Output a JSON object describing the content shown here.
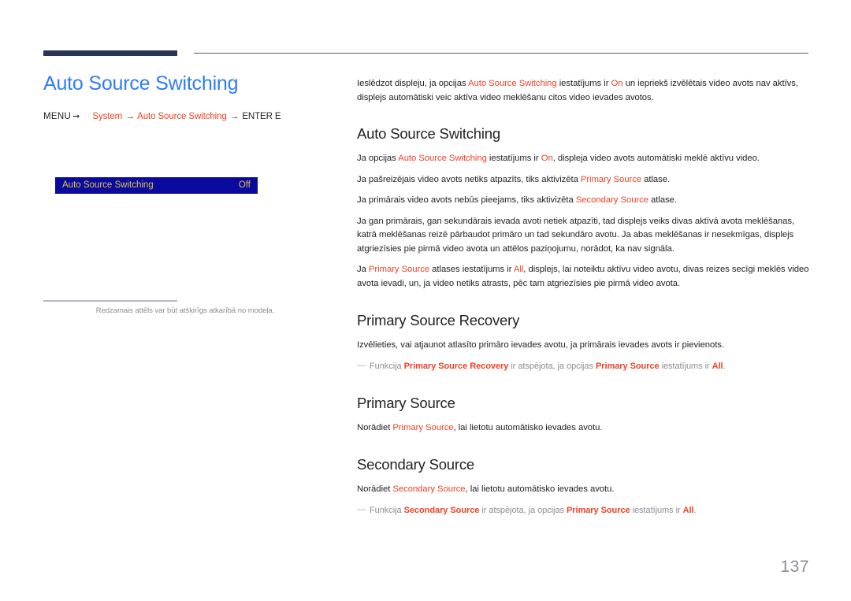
{
  "header": {
    "accent_color": "#2b3356",
    "rule_color": "#5c5a72"
  },
  "left": {
    "title": "Auto Source Switching",
    "title_color": "#2f7cf6",
    "menu": {
      "menu_word": "MENU",
      "return_icon": "return-arrow-icon",
      "step1": "System",
      "arrow1": "→",
      "step2": "Auto Source Switching",
      "arrow2": "→",
      "step3": "ENTER E"
    },
    "osd": {
      "label": "Auto Source Switching",
      "value": "Off",
      "bg_color": "#0a0a9e",
      "text_color": "#e3c14a"
    },
    "caption": "Redzamais attēls var būt atšķirīgs atkarībā no modeļa."
  },
  "right": {
    "intro": {
      "t1": "Ieslēdzot displeju, ja opcijas ",
      "h1": "Auto Source Switching",
      "t2": " iestatījums ir ",
      "h2": "On",
      "t3": " un iepriekš izvēlētais video avots nav aktīvs, displejs automātiski veic aktīva video meklēšanu citos video ievades avotos."
    },
    "sections": [
      {
        "heading": "Auto Source Switching",
        "paragraphs": [
          {
            "t1": "Ja opcijas ",
            "h1": "Auto Source Switching",
            "t2": " iestatījums ir ",
            "h2": "On",
            "t3": ", displeja video avots automātiski meklē aktīvu video."
          },
          {
            "t1": "Ja pašreizējais video avots netiks atpazīts, tiks aktivizēta ",
            "h1": "Primary Source",
            "t2": " atlase."
          },
          {
            "t1": "Ja primārais video avots nebūs pieejams, tiks aktivizēta ",
            "h1": "Secondary Source",
            "t2": " atlase."
          },
          {
            "t1": "Ja gan primārais, gan sekundārais ievada avoti netiek atpazīti, tad displejs veiks divas aktīvā avota meklēšanas, katrā meklēšanas reizē pārbaudot primāro un tad sekundāro avotu. Ja abas meklēšanas ir nesekmīgas, displejs atgriezīsies pie pirmā video avota un attēlos paziņojumu, norādot, ka nav signāla."
          },
          {
            "t1": "Ja ",
            "h1": "Primary Source",
            "t2": " atlases iestatījums ir ",
            "h2": "All",
            "t3": ", displejs, lai noteiktu aktīvu video avotu, divas reizes secīgi meklēs video avota ievadi, un, ja video netiks atrasts, pēc tam atgriezīsies pie pirmā video avota."
          }
        ],
        "notes": []
      },
      {
        "heading": "Primary Source Recovery",
        "paragraphs": [
          {
            "t1": "Izvēlieties, vai atjaunot atlasīto primāro ievades avotu, ja primārais ievades avots ir pievienots."
          }
        ],
        "notes": [
          {
            "dash": "―",
            "t1": "Funkcija ",
            "h1": "Primary Source Recovery",
            "t2": " ir atspējota, ja opcijas ",
            "h2": "Primary Source",
            "t3": " iestatījums ir ",
            "h3": "All",
            "t4": "."
          }
        ]
      },
      {
        "heading": "Primary Source",
        "paragraphs": [
          {
            "t1": "Norādiet ",
            "h1": "Primary Source",
            "t2": ", lai lietotu automātisko ievades avotu."
          }
        ],
        "notes": []
      },
      {
        "heading": "Secondary Source",
        "paragraphs": [
          {
            "t1": "Norādiet ",
            "h1": "Secondary Source",
            "t2": ", lai lietotu automātisko ievades avotu."
          }
        ],
        "notes": [
          {
            "dash": "―",
            "t1": "Funkcija ",
            "h1": "Secondary Source",
            "t2": " ir atspējota, ja opcijas ",
            "h2": "Primary Source",
            "t3": " iestatījums ir ",
            "h3": "All",
            "t4": "."
          }
        ]
      }
    ]
  },
  "footer": {
    "page_number": "137"
  },
  "colors": {
    "highlight": "#ef4123",
    "title_blue": "#2f7cf6",
    "muted": "#8c8c94"
  }
}
